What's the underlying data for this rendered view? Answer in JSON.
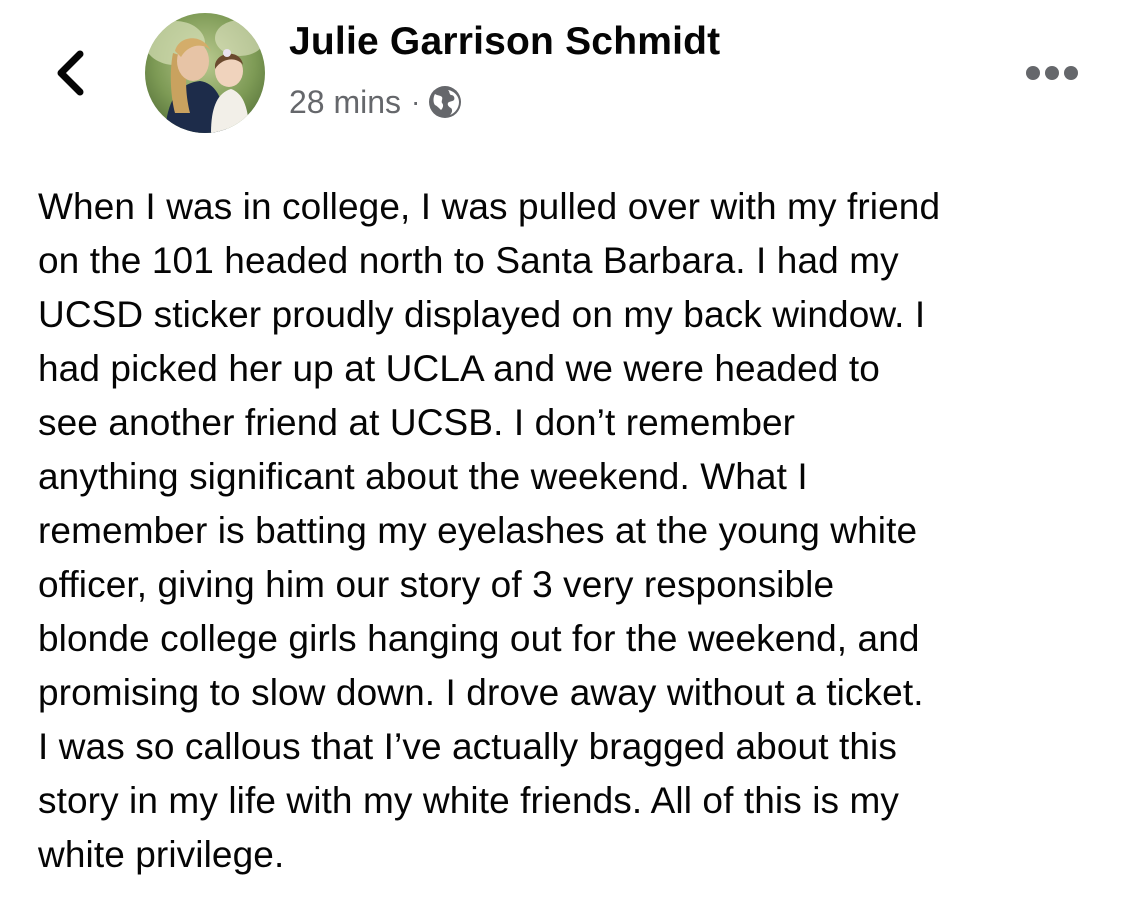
{
  "header": {
    "back_icon": "chevron-left-icon",
    "author_name": "Julie Garrison Schmidt",
    "timestamp": "28 mins",
    "separator": "·",
    "privacy_icon": "globe-icon",
    "more_icon": "more-horizontal-icon"
  },
  "post": {
    "lines": [
      "When I was in college, I was pulled over with my friend",
      "on the 101 headed north to Santa Barbara. I had my",
      "UCSD sticker proudly displayed on my back window. I",
      "had picked her up at UCLA and we were headed to",
      "see another friend at UCSB. I don’t remember",
      "anything significant about the weekend. What I",
      "remember is batting my eyelashes at the young white",
      "officer, giving him our story of 3 very responsible",
      "blonde college girls hanging out for the weekend, and",
      "promising to slow down. I drove away without a ticket.",
      "I was so callous that I’ve actually bragged about this",
      "story in my life with my white friends. All of this is my",
      "white privilege."
    ]
  },
  "colors": {
    "text_primary": "#050505",
    "text_secondary": "#65676b",
    "background": "#ffffff"
  }
}
